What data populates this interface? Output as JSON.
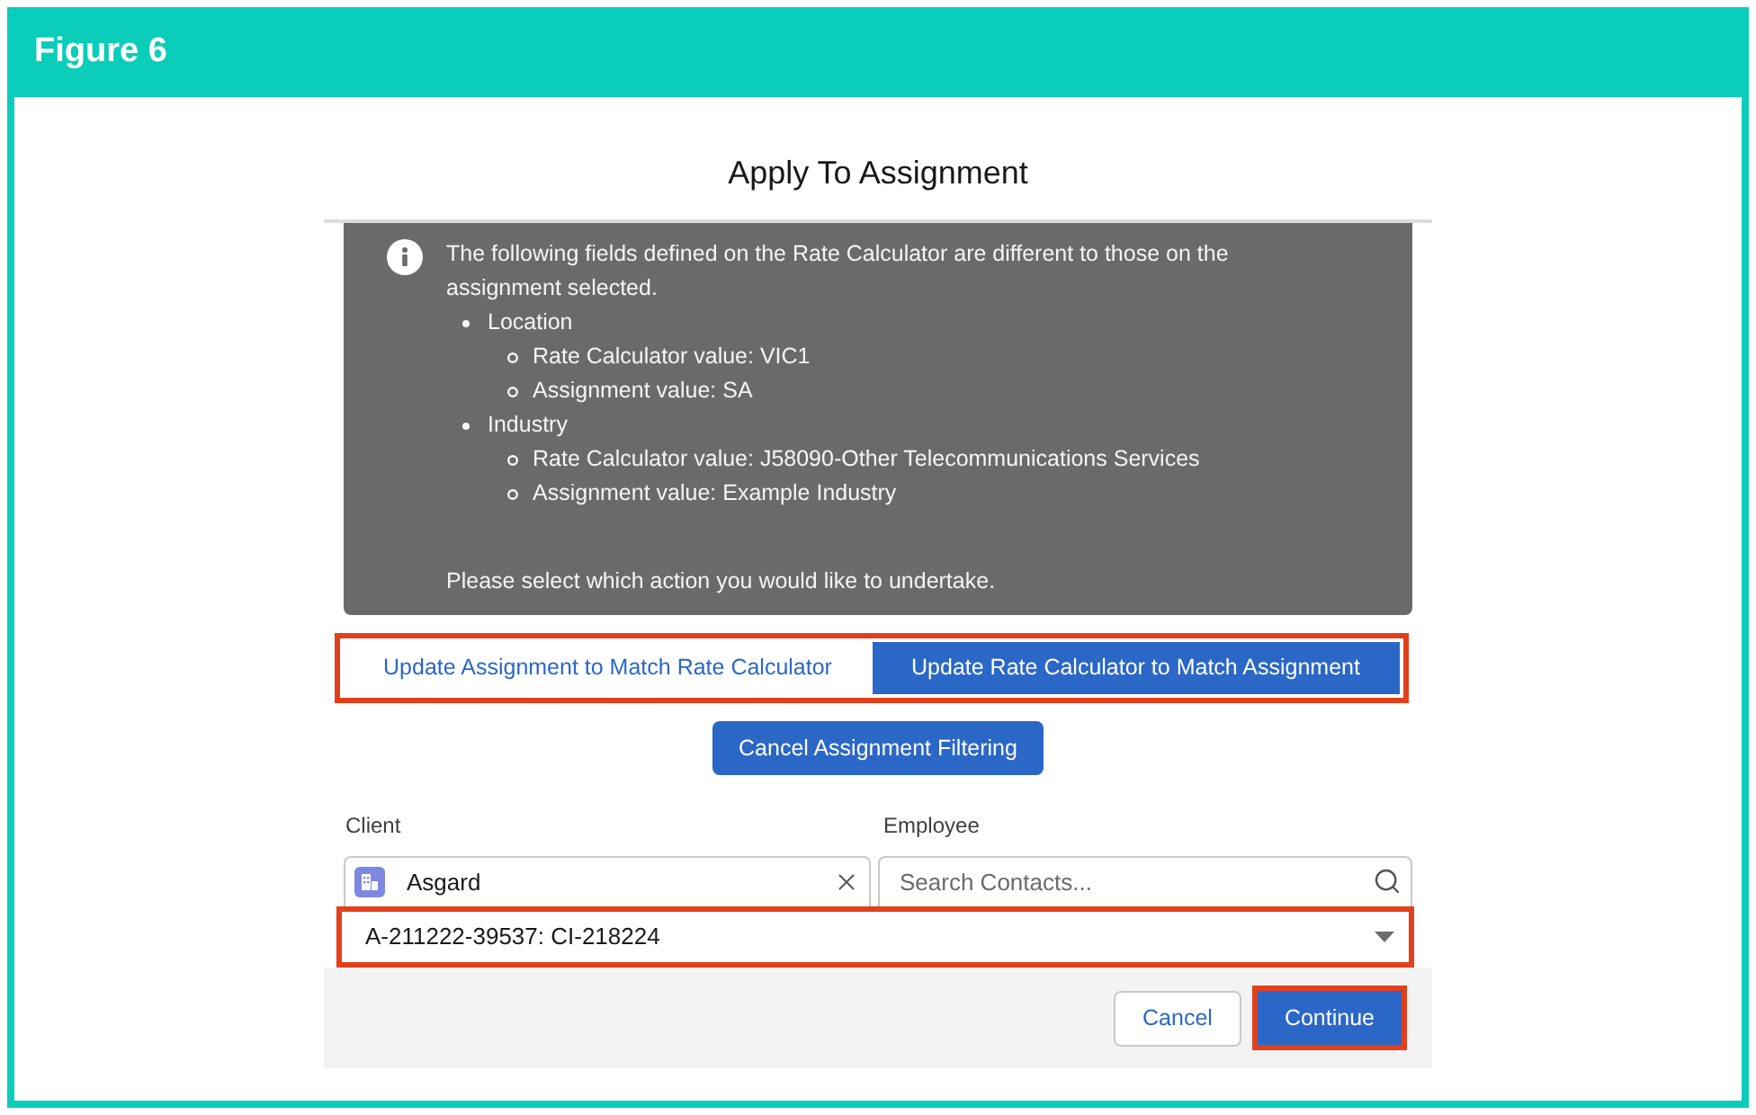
{
  "figure": {
    "label": "Figure 6"
  },
  "dialog": {
    "title": "Apply To Assignment",
    "notice": {
      "intro": "The following fields defined on the Rate Calculator are different to those on the assignment selected.",
      "items": [
        {
          "text": "Location",
          "children": [
            {
              "text": "Rate Calculator value: VIC1"
            },
            {
              "text": "Assignment value: SA"
            }
          ]
        },
        {
          "text": "Industry",
          "children": [
            {
              "text": "Rate Calculator value: J58090-Other Telecommunications Services"
            },
            {
              "text": "Assignment value: Example Industry"
            }
          ]
        }
      ],
      "prompt": "Please select which action you would like to undertake."
    },
    "action_group": {
      "highlighted": true,
      "buttons": [
        {
          "label": "Update Assignment to Match Rate Calculator",
          "selected": false
        },
        {
          "label": "Update Rate Calculator to Match Assignment",
          "selected": true
        }
      ]
    },
    "cancel_filter_button": {
      "label": "Cancel Assignment Filtering"
    },
    "client": {
      "label": "Client",
      "value": "Asgard"
    },
    "employee": {
      "label": "Employee",
      "placeholder": "Search Contacts..."
    },
    "assignment_select": {
      "value": "A-211222-39537: CI-218224",
      "highlighted": true
    },
    "footer": {
      "buttons": [
        {
          "label": "Cancel",
          "kind": "neutral",
          "highlighted": false
        },
        {
          "label": "Continue",
          "kind": "brand",
          "highlighted": true
        }
      ]
    }
  }
}
